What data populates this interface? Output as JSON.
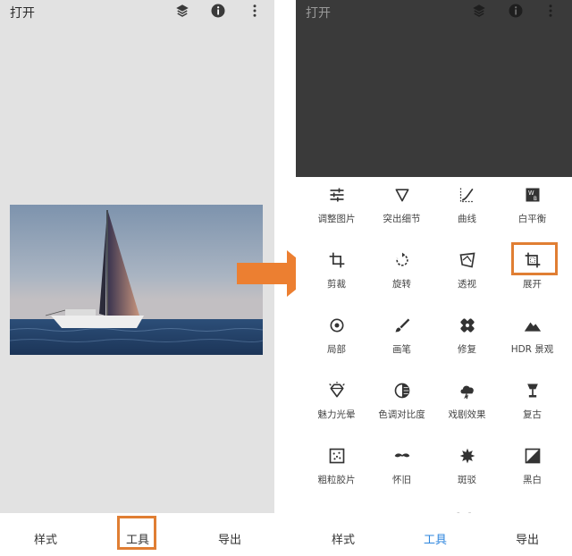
{
  "left": {
    "title": "打开",
    "tabs": [
      {
        "label": "样式",
        "active": false
      },
      {
        "label": "工具",
        "active": false
      },
      {
        "label": "导出",
        "active": false
      }
    ]
  },
  "right": {
    "title": "打开",
    "tools": [
      {
        "label": "调整图片",
        "icon": "tune-sliders-icon"
      },
      {
        "label": "突出细节",
        "icon": "details-triangle-icon"
      },
      {
        "label": "曲线",
        "icon": "curves-icon"
      },
      {
        "label": "白平衡",
        "icon": "white-balance-icon"
      },
      {
        "label": "剪裁",
        "icon": "crop-icon"
      },
      {
        "label": "旋转",
        "icon": "rotate-icon"
      },
      {
        "label": "透视",
        "icon": "perspective-icon"
      },
      {
        "label": "展开",
        "icon": "expand-icon"
      },
      {
        "label": "局部",
        "icon": "selective-target-icon"
      },
      {
        "label": "画笔",
        "icon": "brush-icon"
      },
      {
        "label": "修复",
        "icon": "healing-bandage-icon"
      },
      {
        "label": "HDR 景观",
        "icon": "hdr-mountain-icon"
      },
      {
        "label": "魅力光晕",
        "icon": "glamour-diamond-icon"
      },
      {
        "label": "色调对比度",
        "icon": "tonal-contrast-icon"
      },
      {
        "label": "戏剧效果",
        "icon": "drama-cloud-icon"
      },
      {
        "label": "复古",
        "icon": "vintage-lamp-icon"
      },
      {
        "label": "粗粒胶片",
        "icon": "grainy-film-icon"
      },
      {
        "label": "怀旧",
        "icon": "retrolux-mustache-icon"
      },
      {
        "label": "斑驳",
        "icon": "grunge-icon"
      },
      {
        "label": "黑白",
        "icon": "black-white-icon"
      }
    ],
    "more_indicator": "- -",
    "tabs": [
      {
        "label": "样式",
        "active": false
      },
      {
        "label": "工具",
        "active": true
      },
      {
        "label": "导出",
        "active": false
      }
    ]
  },
  "colors": {
    "highlight": "#e07e33",
    "active_tab": "#2e86de",
    "dark_canvas": "#3a3a3a",
    "light_canvas": "#e2e2e2"
  }
}
